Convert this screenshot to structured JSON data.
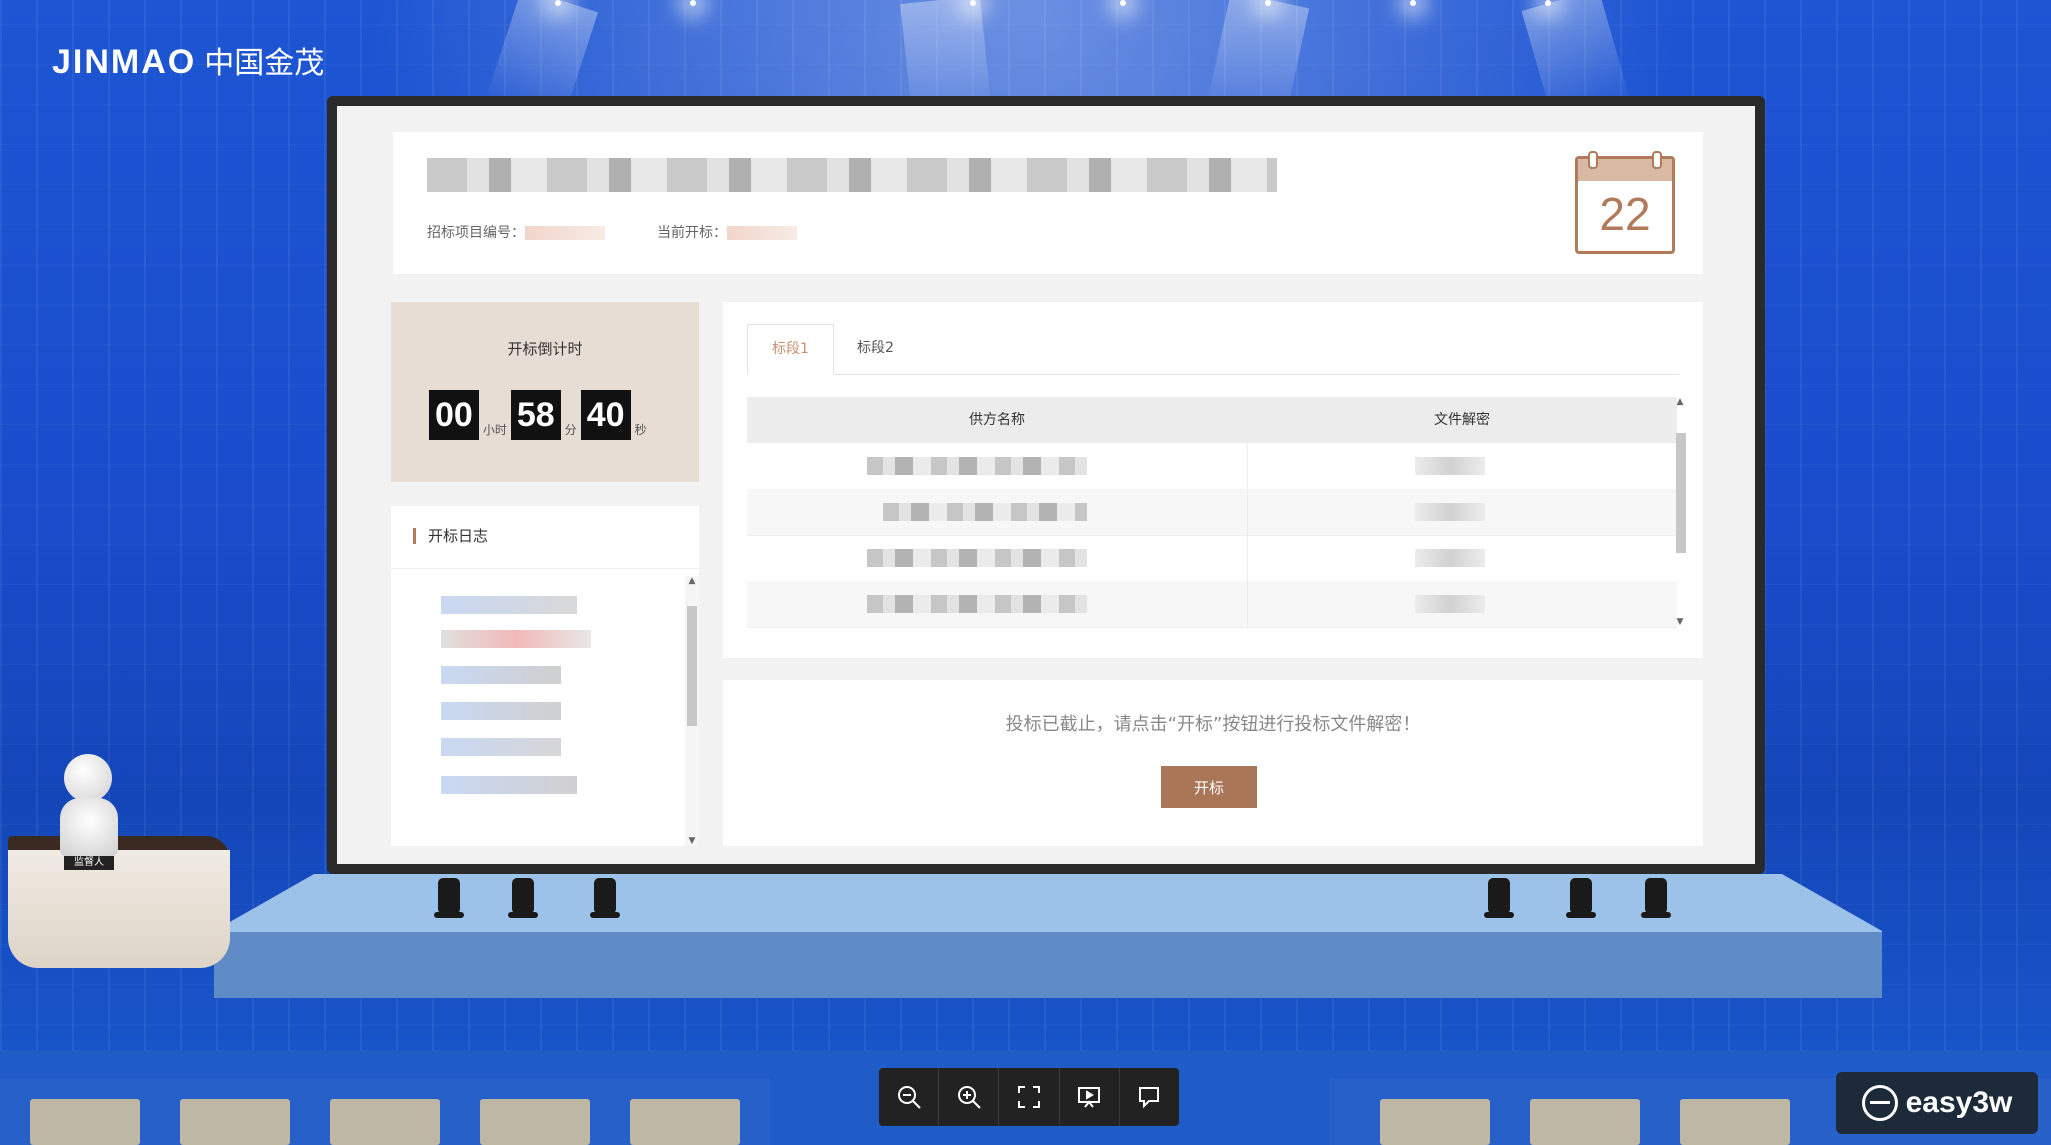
{
  "logo": {
    "en": "JINMAO",
    "cn": "中国金茂"
  },
  "header": {
    "project_no_label": "招标项目编号：",
    "current_bid_label": "当前开标：",
    "calendar_day": "22"
  },
  "countdown": {
    "title": "开标倒计时",
    "hours": "00",
    "hours_unit": "小时",
    "minutes": "58",
    "minutes_unit": "分",
    "seconds": "40",
    "seconds_unit": "秒"
  },
  "log": {
    "title": "开标日志"
  },
  "tabs": [
    "标段1",
    "标段2"
  ],
  "table": {
    "columns": [
      "供方名称",
      "文件解密"
    ],
    "row_count": 4
  },
  "notice": "投标已截止，请点击“开标”按钮进行投标文件解密！",
  "open_button": "开标",
  "podium_badge": "监督人",
  "toolbar": {
    "icons": [
      "zoom-out-icon",
      "zoom-in-icon",
      "fullscreen-icon",
      "present-icon",
      "comment-icon"
    ]
  },
  "brand": "easy3w",
  "colors": {
    "accent": "#a97657",
    "accent_tab": "#c8906e",
    "background_blue": "#1a4ccc"
  }
}
